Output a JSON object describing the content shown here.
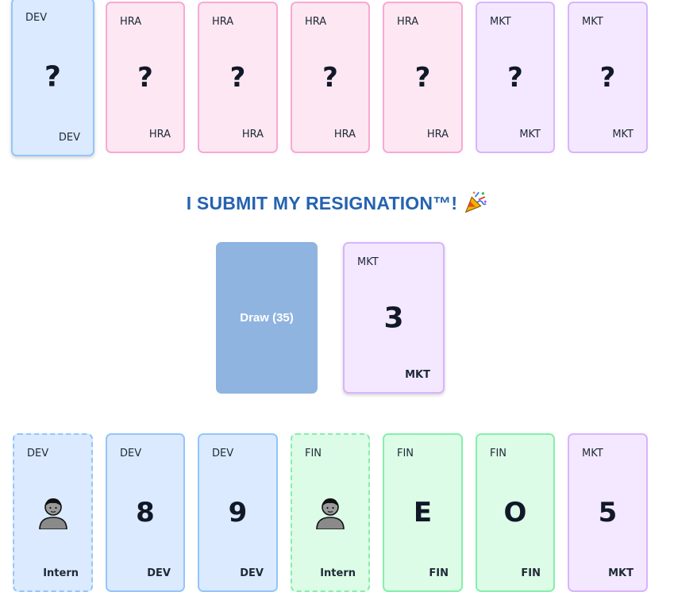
{
  "opponent_hand": [
    {
      "dept": "DEV",
      "face": "?",
      "style": "dev",
      "dashed": false
    },
    {
      "dept": "HRA",
      "face": "?",
      "style": "hra",
      "dashed": false
    },
    {
      "dept": "HRA",
      "face": "?",
      "style": "hra",
      "dashed": false
    },
    {
      "dept": "HRA",
      "face": "?",
      "style": "hra",
      "dashed": false
    },
    {
      "dept": "HRA",
      "face": "?",
      "style": "hra",
      "dashed": false
    },
    {
      "dept": "MKT",
      "face": "?",
      "style": "mkt",
      "dashed": false
    },
    {
      "dept": "MKT",
      "face": "?",
      "style": "mkt",
      "dashed": false
    }
  ],
  "status": {
    "message": "I SUBMIT MY RESIGNATION™!",
    "icon": "party-popper-icon"
  },
  "draw_pile": {
    "label": "Draw (35)"
  },
  "discard_pile": {
    "dept": "MKT",
    "face": "3",
    "bottom": "MKT"
  },
  "player_hand": [
    {
      "dept": "DEV",
      "face": "",
      "bottom": "Intern",
      "style": "dev",
      "dashed": true,
      "intern": true,
      "icon": "intern-icon"
    },
    {
      "dept": "DEV",
      "face": "8",
      "bottom": "DEV",
      "style": "dev",
      "dashed": false,
      "intern": false
    },
    {
      "dept": "DEV",
      "face": "9",
      "bottom": "DEV",
      "style": "dev",
      "dashed": false,
      "intern": false
    },
    {
      "dept": "FIN",
      "face": "",
      "bottom": "Intern",
      "style": "fin",
      "dashed": true,
      "intern": true,
      "icon": "intern-icon"
    },
    {
      "dept": "FIN",
      "face": "E",
      "bottom": "FIN",
      "style": "fin",
      "dashed": false,
      "intern": false
    },
    {
      "dept": "FIN",
      "face": "O",
      "bottom": "FIN",
      "style": "fin",
      "dashed": false,
      "intern": false
    },
    {
      "dept": "MKT",
      "face": "5",
      "bottom": "MKT",
      "style": "mkt",
      "dashed": false,
      "intern": false
    }
  ]
}
